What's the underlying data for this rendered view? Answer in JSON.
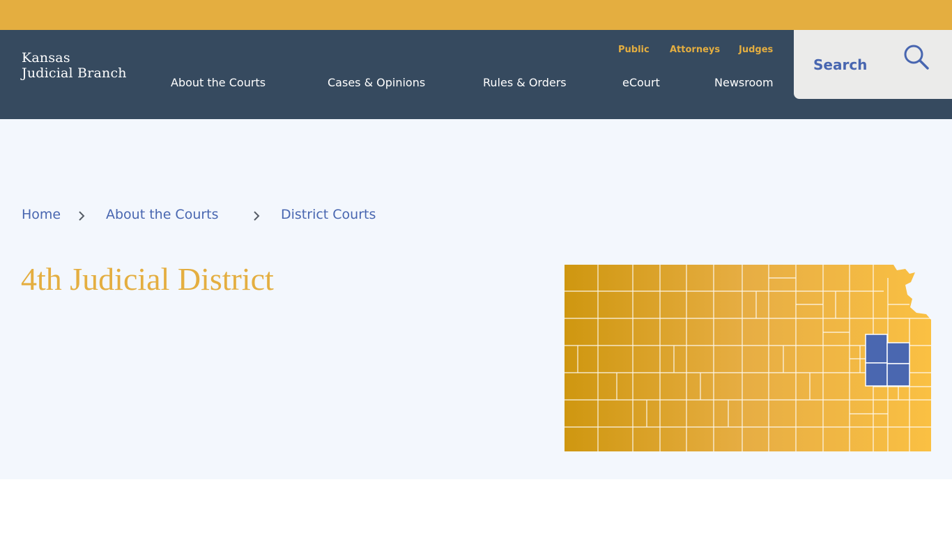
{
  "header": {
    "logo_line1": "Kansas",
    "logo_line2": "Judicial Branch",
    "utility_nav": [
      "Public",
      "Attorneys",
      "Judges"
    ],
    "main_nav": [
      "About the Courts",
      "Cases & Opinions",
      "Rules & Orders",
      "eCourt",
      "Newsroom"
    ],
    "search_label": "Search"
  },
  "breadcrumb": [
    "Home",
    "About the Courts",
    "District Courts"
  ],
  "page_title": "4th Judicial District",
  "colors": {
    "top_band": "#e4ae40",
    "header_bg": "#364a5f",
    "accent_gold": "#e4ae40",
    "link_blue": "#4866b0",
    "hero_bg": "#f3f7fd",
    "map_highlight": "#4a67b0"
  },
  "icons": {
    "search": "magnifier-icon",
    "breadcrumb_separator": "chevron-right-icon",
    "map": "kansas-county-map"
  }
}
